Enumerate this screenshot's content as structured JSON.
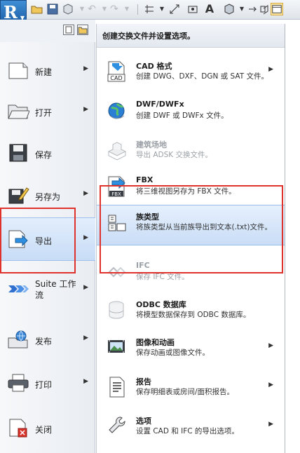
{
  "app": {
    "logo_letter": "R"
  },
  "quick_access": {
    "icons": [
      "open-icon",
      "save-icon",
      "sync-icon",
      "undo-icon",
      "redo-icon",
      "measure-icon",
      "dimension-icon",
      "tag-icon",
      "text-icon",
      "3d-view-icon",
      "section-icon",
      "model-icon",
      "switch-window-icon"
    ],
    "text_tool_glyph": "A"
  },
  "left_menu": {
    "items": [
      {
        "id": "new",
        "label": "新建",
        "has_arrow": true
      },
      {
        "id": "open",
        "label": "打开",
        "has_arrow": true
      },
      {
        "id": "save",
        "label": "保存",
        "has_arrow": false
      },
      {
        "id": "save_as",
        "label": "另存为",
        "has_arrow": true
      },
      {
        "id": "export",
        "label": "导出",
        "has_arrow": true,
        "selected": true
      },
      {
        "id": "suite",
        "label": "Suite 工作流",
        "has_arrow": true
      },
      {
        "id": "publish",
        "label": "发布",
        "has_arrow": true
      },
      {
        "id": "print",
        "label": "打印",
        "has_arrow": true
      },
      {
        "id": "close",
        "label": "关闭",
        "has_arrow": false
      }
    ]
  },
  "export_panel": {
    "header": "创建交换文件并设置选项。",
    "options": [
      {
        "id": "cad",
        "title": "CAD 格式",
        "desc": "创建 DWG、DXF、DGN 或 SAT 文件。",
        "has_arrow": true,
        "icon_text": "CAD"
      },
      {
        "id": "dwf",
        "title": "DWF/DWFx",
        "desc": "创建 DWF 或 DWFx 文件。",
        "has_arrow": false
      },
      {
        "id": "site",
        "title": "建筑场地",
        "desc": "导出 ADSK 交换文件。",
        "has_arrow": false,
        "dim": true
      },
      {
        "id": "fbx",
        "title": "FBX",
        "desc": "将三维视图另存为 FBX 文件。",
        "has_arrow": false,
        "icon_text": "FBX"
      },
      {
        "id": "family_types",
        "title": "族类型",
        "desc": "将族类型从当前族导出到文本(.txt)文件。",
        "has_arrow": false,
        "selected": true
      },
      {
        "id": "ifc",
        "title": "IFC",
        "desc": "保存 IFC 文件。",
        "has_arrow": false,
        "dim": true
      },
      {
        "id": "odbc",
        "title": "ODBC 数据库",
        "desc": "将模型数据保存到 ODBC 数据库。",
        "has_arrow": false,
        "dim_icon": true
      },
      {
        "id": "images",
        "title": "图像和动画",
        "desc": "保存动画或图像文件。",
        "has_arrow": true
      },
      {
        "id": "reports",
        "title": "报告",
        "desc": "保存明细表或房间/面积报告。",
        "has_arrow": true
      },
      {
        "id": "options",
        "title": "选项",
        "desc": "设置 CAD 和 IFC 的导出选项。",
        "has_arrow": true
      }
    ]
  },
  "colors": {
    "highlight_box": "#e0322c",
    "selection": "#c9ddf6",
    "app_blue": "#1c5ea6"
  }
}
